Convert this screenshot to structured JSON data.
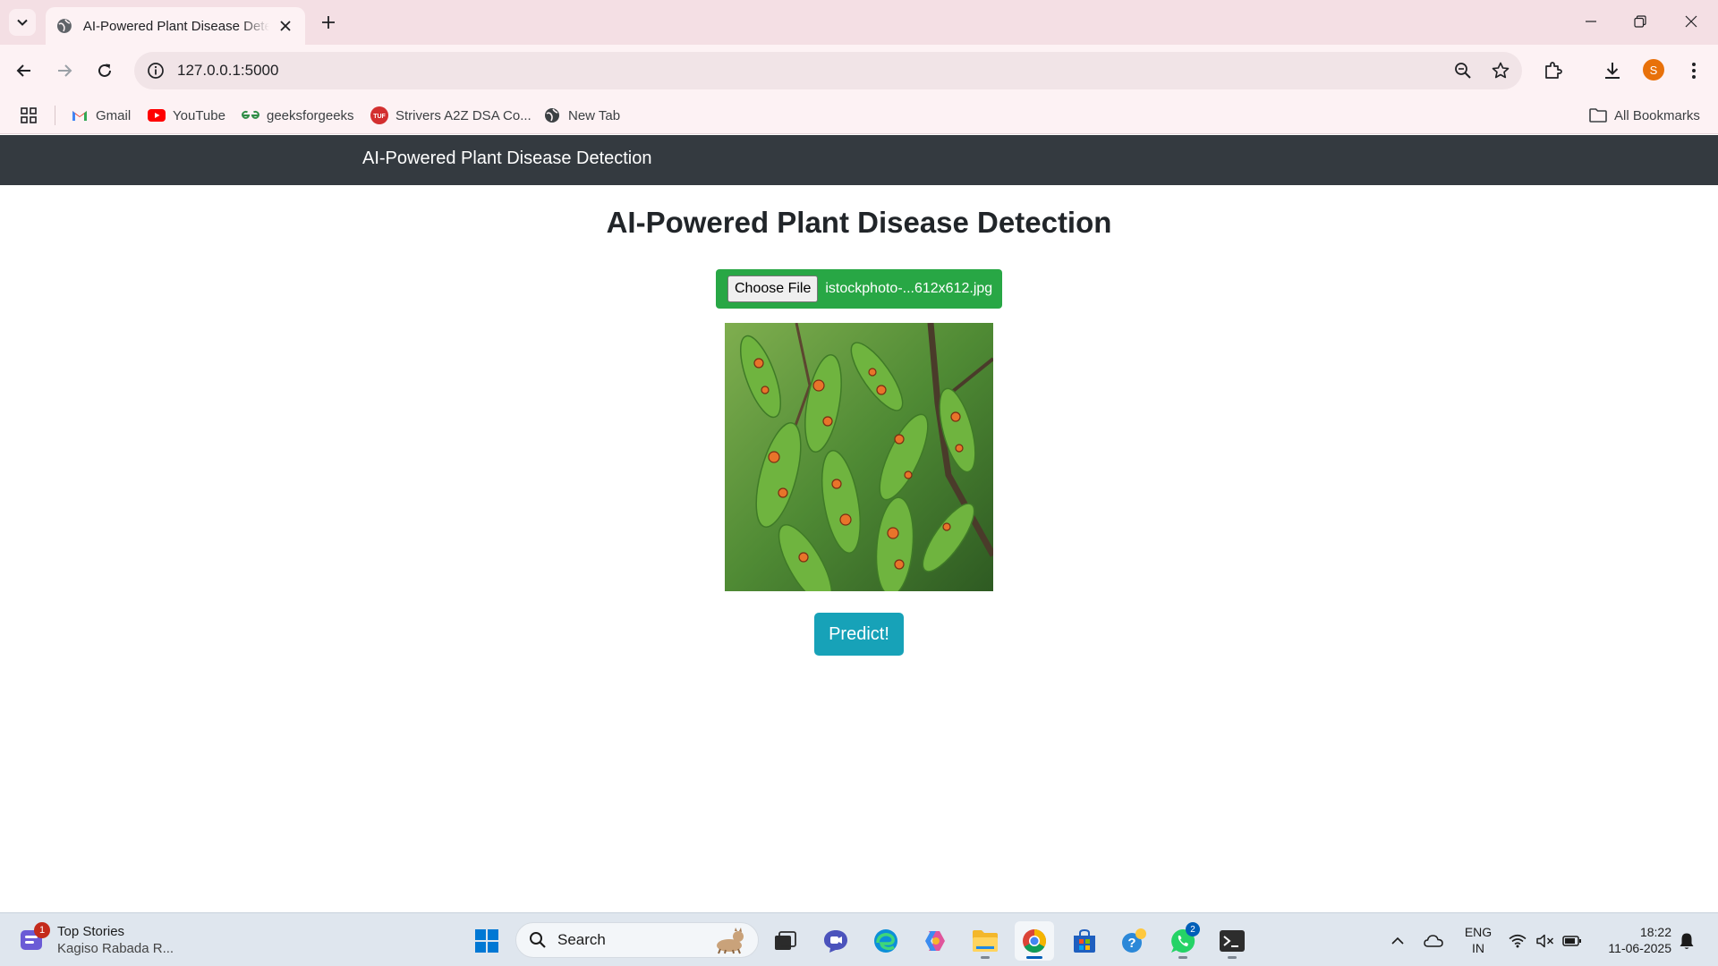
{
  "browser": {
    "tab": {
      "title": "AI-Powered Plant Disease Detection"
    },
    "url": "127.0.0.1:5000",
    "profile_initial": "S",
    "bookmarks": [
      {
        "label": "Gmail"
      },
      {
        "label": "YouTube"
      },
      {
        "label": "geeksforgeeks"
      },
      {
        "label": "Strivers A2Z DSA Co..."
      },
      {
        "label": "New Tab"
      }
    ],
    "all_bookmarks_label": "All Bookmarks"
  },
  "page": {
    "navbar_brand": "AI-Powered Plant Disease Detection",
    "heading": "AI-Powered Plant Disease Detection",
    "file_input": {
      "button_label": "Choose File",
      "file_name": "istockphoto-...612x612.jpg"
    },
    "predict_label": "Predict!",
    "colors": {
      "navbar": "#343a40",
      "file_box": "#28a745",
      "predict_button": "#17a2b8"
    }
  },
  "taskbar": {
    "news": {
      "title": "Top Stories",
      "subtitle": "Kagiso Rabada R...",
      "badge": "1"
    },
    "search_label": "Search",
    "whatsapp_badge": "2",
    "language": {
      "line1": "ENG",
      "line2": "IN"
    },
    "clock": {
      "time": "18:22",
      "date": "11-06-2025"
    }
  }
}
